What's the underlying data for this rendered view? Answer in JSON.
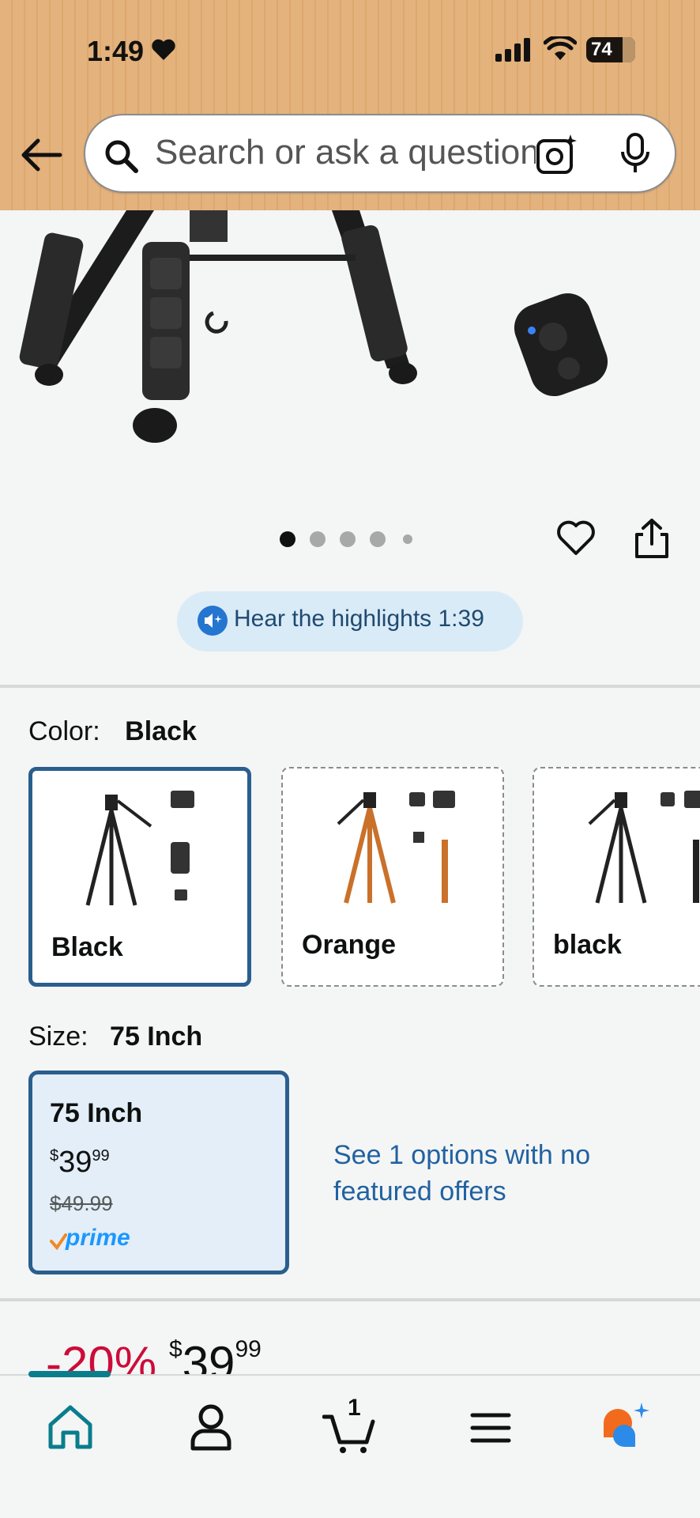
{
  "status_bar": {
    "time": "1:49",
    "battery": "74"
  },
  "search": {
    "placeholder": "Search or ask a question"
  },
  "gallery": {
    "image_count": 5,
    "active_index": 0
  },
  "highlights": {
    "label": "Hear the highlights 1:39"
  },
  "color": {
    "label": "Color:",
    "selected": "Black",
    "options": [
      {
        "name": "Black",
        "selected": true
      },
      {
        "name": "Orange",
        "selected": false
      },
      {
        "name": "black",
        "selected": false
      }
    ]
  },
  "size": {
    "label": "Size:",
    "selected": "75 Inch",
    "card": {
      "name": "75 Inch",
      "price_symbol": "$",
      "price_whole": "39",
      "price_fraction": "99",
      "list_price": "$49.99",
      "prime": "prime"
    },
    "see_options": "See 1 options with no featured offers"
  },
  "price": {
    "discount": "-20%",
    "symbol": "$",
    "whole": "39",
    "fraction": "99"
  },
  "nav": {
    "cart_count": "1",
    "items": [
      "home-icon",
      "account-icon",
      "cart-icon",
      "menu-icon",
      "rufus-icon"
    ]
  },
  "colors": {
    "header": "#e4b27c",
    "accent": "#2a5e8f",
    "link": "#2162a1",
    "discount": "#cc0c39",
    "prime": "#1a98ff"
  }
}
